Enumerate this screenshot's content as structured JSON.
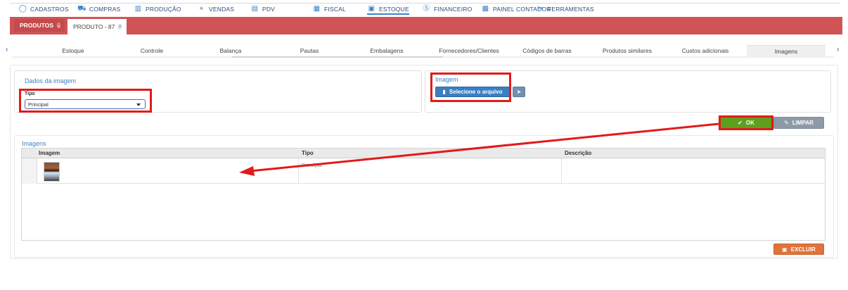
{
  "topmenu": {
    "items": [
      {
        "label": "CADASTROS",
        "icon": "circle-icon"
      },
      {
        "label": "COMPRAS",
        "icon": "cart-icon"
      },
      {
        "label": "PRODUÇÃO",
        "icon": "factory-icon"
      },
      {
        "label": "VENDAS",
        "icon": "tag-icon"
      },
      {
        "label": "PDV",
        "icon": "store-icon"
      },
      {
        "label": "FISCAL",
        "icon": "document-icon"
      },
      {
        "label": "ESTOQUE",
        "icon": "box-icon"
      },
      {
        "label": "FINANCEIRO",
        "icon": "dollar-icon"
      },
      {
        "label": "PAINEL CONTADOR",
        "icon": "calculator-icon"
      },
      {
        "label": "FERRAMENTAS",
        "icon": "tools-icon"
      }
    ],
    "active": "ESTOQUE"
  },
  "tabbar": {
    "tabs": [
      {
        "label": "PRODUTOS"
      },
      {
        "label": "PRODUTO - 87"
      }
    ],
    "color": "#d05456"
  },
  "subtabs": {
    "items": [
      "Estoque",
      "Controle",
      "Balança",
      "Pautas",
      "Embalagens",
      "Fornecedores/Clientes",
      "Códigos de barras",
      "Produtos similares",
      "Custos adicionais",
      "Imagens"
    ],
    "active": "Imagens"
  },
  "dados": {
    "title": "Dados da imagem",
    "tipo_label": "Tipo",
    "tipo_value": "Principal"
  },
  "imagem": {
    "title": "Imagem",
    "select_button": "Selecione o arquivo"
  },
  "actions": {
    "ok": "OK",
    "limpar": "LIMPAR",
    "excluir": "EXCLUIR"
  },
  "imagens": {
    "title": "Imagens",
    "columns": [
      "Imagem",
      "Tipo",
      "Descrição"
    ],
    "rows": [
      {
        "tipo": "Principal",
        "descricao": ""
      }
    ]
  },
  "colors": {
    "accent": "#3d83c4",
    "highlight_red": "#e21a1a",
    "ok_green": "#5f9f1e",
    "excluir_orange": "#e0733c"
  }
}
